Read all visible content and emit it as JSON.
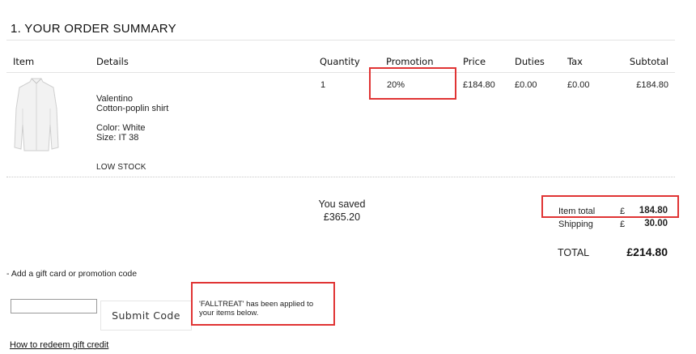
{
  "section_title": "1. YOUR ORDER SUMMARY",
  "columns": {
    "item": "Item",
    "details": "Details",
    "quantity": "Quantity",
    "promotion": "Promotion",
    "price": "Price",
    "duties": "Duties",
    "tax": "Tax",
    "subtotal": "Subtotal"
  },
  "product": {
    "brand": "Valentino",
    "name": "Cotton-poplin shirt",
    "color": "Color: White",
    "size": "Size: IT 38",
    "stock": "LOW STOCK",
    "quantity": "1",
    "promotion": "20%",
    "price": "£184.80",
    "duties": "£0.00",
    "tax": "£0.00",
    "subtotal": "£184.80"
  },
  "savings": {
    "label": "You saved",
    "amount": "£365.20"
  },
  "totals": {
    "item_total_label": "Item total",
    "item_total_currency": "£",
    "item_total_value": "184.80",
    "shipping_label": "Shipping",
    "shipping_currency": "£",
    "shipping_value": "30.00",
    "total_label": "TOTAL",
    "total_value": "£214.80"
  },
  "promo": {
    "toggle_label": "- Add a gift card or promotion code",
    "input_value": "",
    "submit_label": "Submit Code",
    "applied_message": "'FALLTREAT' has been applied to your items below.",
    "redeem_link": "How to redeem gift credit"
  },
  "colors": {
    "highlight": "#e03434"
  }
}
